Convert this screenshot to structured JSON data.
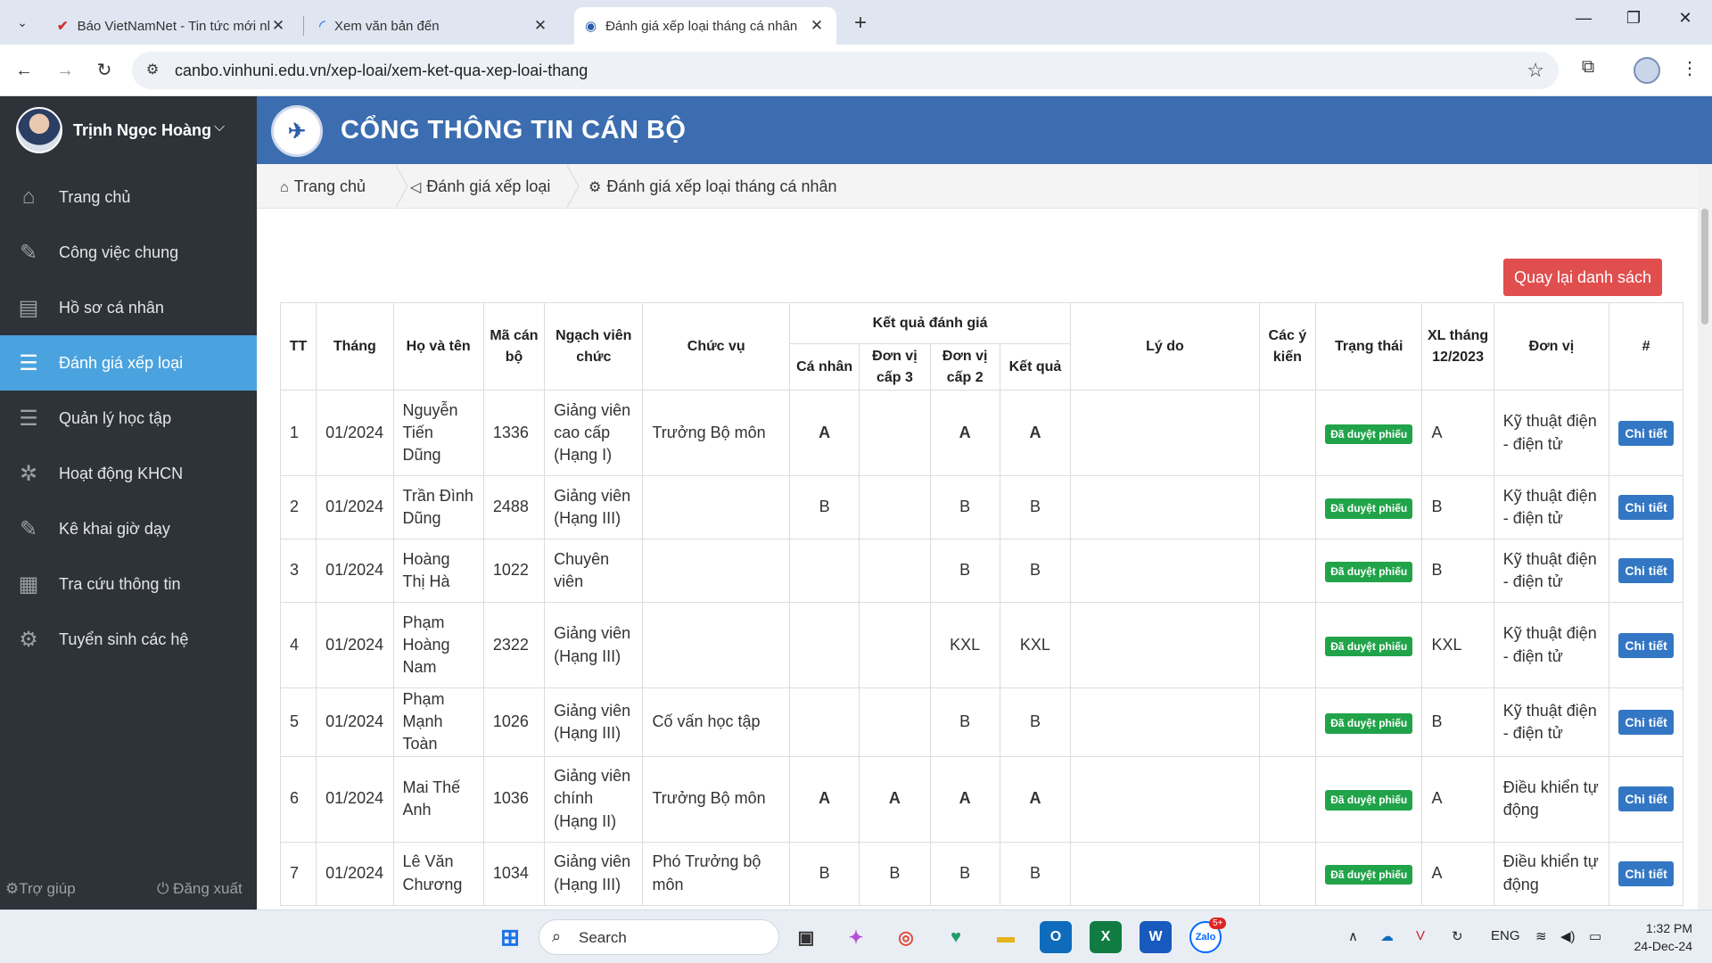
{
  "browser": {
    "tabs": [
      {
        "title": "Báo VietNamNet - Tin tức mới nhất"
      },
      {
        "title": "Xem văn bản đến"
      },
      {
        "title": "Đánh giá xếp loại tháng cá nhân"
      }
    ],
    "new_tab": "+",
    "url": "canbo.vinhuni.edu.vn/xep-loai/xem-ket-qua-xep-loai-thang"
  },
  "sidebar": {
    "user_name": "Trịnh Ngọc Hoàng",
    "items": [
      {
        "label": "Trang chủ"
      },
      {
        "label": "Công việc chung"
      },
      {
        "label": "Hồ sơ cá nhân"
      },
      {
        "label": "Đánh giá xếp loại"
      },
      {
        "label": "Quản lý học tập"
      },
      {
        "label": "Hoạt động KHCN"
      },
      {
        "label": "Kê khai giờ dạy"
      },
      {
        "label": "Tra cứu thông tin"
      },
      {
        "label": "Tuyển sinh các hệ"
      }
    ],
    "help": "Trợ giúp",
    "logout": "Đăng xuất"
  },
  "header": {
    "title": "CỔNG THÔNG TIN CÁN BỘ"
  },
  "breadcrumb": {
    "home": "Trang chủ",
    "section": "Đánh giá xếp loại",
    "page": "Đánh giá xếp loại tháng cá nhân"
  },
  "actions": {
    "back_label": "Quay lại danh sách"
  },
  "table": {
    "headers": {
      "tt": "TT",
      "thang": "Tháng",
      "ho_ten": "Họ và tên",
      "ma_can_bo": "Mã cán bộ",
      "ngach": "Ngạch viên chức",
      "chuc_vu": "Chức vụ",
      "ket_qua_group": "Kết quả đánh giá",
      "ca_nhan": "Cá nhân",
      "cap3": "Đơn vị cấp 3",
      "cap2": "Đơn vị cấp 2",
      "ket_qua": "Kết quả",
      "ly_do": "Lý do",
      "y_kien": "Các ý kiến",
      "trang_thai": "Trạng thái",
      "xl_thang": "XL tháng 12/2023",
      "don_vi": "Đơn vị",
      "hash": "#"
    },
    "rows": [
      {
        "tt": "1",
        "thang": "01/2024",
        "ho_ten": "Nguyễn Tiến Dũng",
        "ma": "1336",
        "ngach": "Giảng viên cao cấp (Hạng I)",
        "chuc_vu": "Trưởng Bộ môn",
        "ca_nhan": "A",
        "cap3": "",
        "cap2": "A",
        "ket_qua": "A",
        "ly_do": "",
        "y_kien": "",
        "trang_thai": "Đã duyệt phiếu",
        "xl": "A",
        "don_vi": "Kỹ thuật điện - điện tử",
        "action": "Chi tiết"
      },
      {
        "tt": "2",
        "thang": "01/2024",
        "ho_ten": "Trần Đình Dũng",
        "ma": "2488",
        "ngach": "Giảng viên (Hạng III)",
        "chuc_vu": "",
        "ca_nhan": "B",
        "cap3": "",
        "cap2": "B",
        "ket_qua": "B",
        "ly_do": "",
        "y_kien": "",
        "trang_thai": "Đã duyệt phiếu",
        "xl": "B",
        "don_vi": "Kỹ thuật điện - điện tử",
        "action": "Chi tiết"
      },
      {
        "tt": "3",
        "thang": "01/2024",
        "ho_ten": "Hoàng Thị Hà",
        "ma": "1022",
        "ngach": "Chuyên viên",
        "chuc_vu": "",
        "ca_nhan": "",
        "cap3": "",
        "cap2": "B",
        "ket_qua": "B",
        "ly_do": "",
        "y_kien": "",
        "trang_thai": "Đã duyệt phiếu",
        "xl": "B",
        "don_vi": "Kỹ thuật điện - điện tử",
        "action": "Chi tiết"
      },
      {
        "tt": "4",
        "thang": "01/2024",
        "ho_ten": "Phạm Hoàng Nam",
        "ma": "2322",
        "ngach": "Giảng viên (Hạng III)",
        "chuc_vu": "",
        "ca_nhan": "",
        "cap3": "",
        "cap2": "KXL",
        "ket_qua": "KXL",
        "ly_do": "",
        "y_kien": "",
        "trang_thai": "Đã duyệt phiếu",
        "xl": "KXL",
        "don_vi": "Kỹ thuật điện - điện tử",
        "action": "Chi tiết"
      },
      {
        "tt": "5",
        "thang": "01/2024",
        "ho_ten": "Phạm Mạnh Toàn",
        "ma": "1026",
        "ngach": "Giảng viên (Hạng III)",
        "chuc_vu": "Cố vấn học tập",
        "ca_nhan": "",
        "cap3": "",
        "cap2": "B",
        "ket_qua": "B",
        "ly_do": "",
        "y_kien": "",
        "trang_thai": "Đã duyệt phiếu",
        "xl": "B",
        "don_vi": "Kỹ thuật điện - điện tử",
        "action": "Chi tiết"
      },
      {
        "tt": "6",
        "thang": "01/2024",
        "ho_ten": "Mai Thế Anh",
        "ma": "1036",
        "ngach": "Giảng viên chính (Hạng II)",
        "chuc_vu": "Trưởng Bộ môn",
        "ca_nhan": "A",
        "cap3": "A",
        "cap2": "A",
        "ket_qua": "A",
        "ly_do": "",
        "y_kien": "",
        "trang_thai": "Đã duyệt phiếu",
        "xl": "A",
        "don_vi": "Điều khiển tự động",
        "action": "Chi tiết"
      },
      {
        "tt": "7",
        "thang": "01/2024",
        "ho_ten": "Lê Văn Chương",
        "ma": "1034",
        "ngach": "Giảng viên (Hạng III)",
        "chuc_vu": "Phó Trưởng bộ môn",
        "ca_nhan": "B",
        "cap3": "B",
        "cap2": "B",
        "ket_qua": "B",
        "ly_do": "",
        "y_kien": "",
        "trang_thai": "Đã duyệt phiếu",
        "xl": "A",
        "don_vi": "Điều khiển tự động",
        "action": "Chi tiết"
      }
    ]
  },
  "taskbar": {
    "search_label": "Search",
    "language": "ENG",
    "time": "1:32 PM",
    "date": "24-Dec-24",
    "zalo_badge": "5+"
  },
  "colors": {
    "header_blue": "#3b6db0",
    "sidebar_bg": "#2d3338",
    "active_item": "#4aa3df",
    "grade_a": "#e00000",
    "status_green": "#21a34a",
    "detail_blue": "#3377c4",
    "back_red": "#e04e4e"
  }
}
